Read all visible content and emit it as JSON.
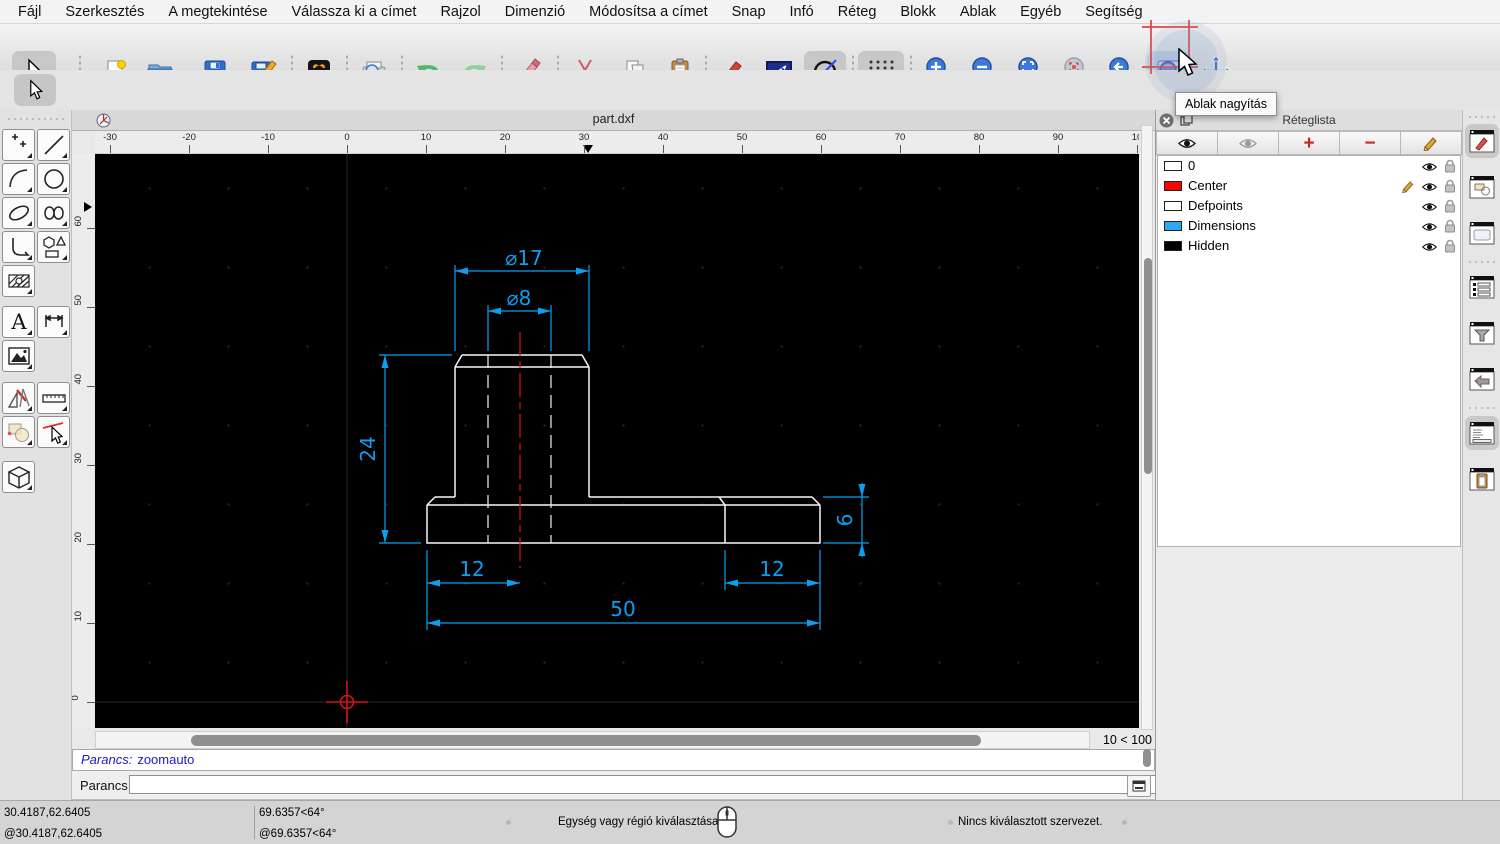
{
  "menu": {
    "items": [
      "Fájl",
      "Szerkesztés",
      "A megtekintése",
      "Válassza ki a címet",
      "Rajzol",
      "Dimenzió",
      "Módosítsa a címet",
      "Snap",
      "Infó",
      "Réteg",
      "Blokk",
      "Ablak",
      "Egyéb",
      "Segítség"
    ]
  },
  "toolbar": {
    "buttons": [
      "select-cursor",
      "new-file",
      "open-file",
      "save",
      "save-as",
      "svg-export",
      "print-preview",
      "undo",
      "redo",
      "delete-eraser",
      "cut",
      "copy",
      "paste",
      "attributes-pencil",
      "draft-view",
      "construction-lines",
      "grid-toggle",
      "zoom-in",
      "zoom-out",
      "zoom-auto",
      "zoom-selection",
      "zoom-previous",
      "zoom-window",
      "pan"
    ],
    "pressed": [
      "select-cursor",
      "construction-lines",
      "grid-toggle",
      "zoom-window"
    ]
  },
  "tooltip": {
    "text": "Ablak nagyítás"
  },
  "drawing_window": {
    "title": "part.dxf",
    "h_ruler": [
      "-30",
      "-20",
      "-10",
      "0",
      "10",
      "20",
      "30",
      "40",
      "50",
      "60",
      "70",
      "80",
      "90",
      "10"
    ],
    "v_ruler": [
      "60",
      "50",
      "40",
      "30",
      "20",
      "10",
      "0"
    ],
    "zoom_indicator": "10 < 100"
  },
  "drawing": {
    "dimensions": {
      "dia17": "⌀17",
      "dia8": "⌀8",
      "height24": "24",
      "thickness6": "6",
      "offset12_left": "12",
      "offset12_right": "12",
      "width50": "50"
    },
    "colors": {
      "geometry": "#f8f8f8",
      "dimension": "#0b9ff0",
      "centerline": "#e01010",
      "background": "#000000"
    }
  },
  "layer_panel": {
    "title": "Réteglista",
    "toolbar_icons": [
      "show-all-eye",
      "hide-all-eye",
      "add-layer-plus",
      "remove-layer-minus",
      "edit-layer-pencil"
    ],
    "icons": {
      "plus": "+",
      "minus": "−"
    },
    "layers": [
      {
        "name": "0",
        "color": "#ffffff",
        "visible": true,
        "locked": false,
        "editing": false
      },
      {
        "name": "Center",
        "color": "#ff0000",
        "visible": true,
        "locked": false,
        "editing": true
      },
      {
        "name": "Defpoints",
        "color": "#ffffff",
        "visible": true,
        "locked": false,
        "editing": false
      },
      {
        "name": "Dimensions",
        "color": "#2da9f2",
        "visible": true,
        "locked": false,
        "editing": false
      },
      {
        "name": "Hidden",
        "color": "#000000",
        "visible": true,
        "locked": false,
        "editing": false
      }
    ]
  },
  "dock": {
    "items": [
      "pen-panel",
      "shapes-panel",
      "blank-panel",
      "layer-list-panel",
      "filter-panel",
      "block-panel",
      "command-panel",
      "clipboard-panel"
    ],
    "active": [
      "pen-panel",
      "command-panel"
    ]
  },
  "command": {
    "history_label": "Parancs:",
    "history_value": "zoomauto",
    "prompt_label": "Parancs:",
    "input_value": ""
  },
  "status_bar": {
    "abs_coord": "30.4187,62.6405",
    "rel_coord": "@30.4187,62.6405",
    "abs_polar": "69.6357<64°",
    "rel_polar": "@69.6357<64°",
    "hint": "Egység vagy régió kiválasztása",
    "selection": "Nincs kiválasztott szervezet."
  }
}
